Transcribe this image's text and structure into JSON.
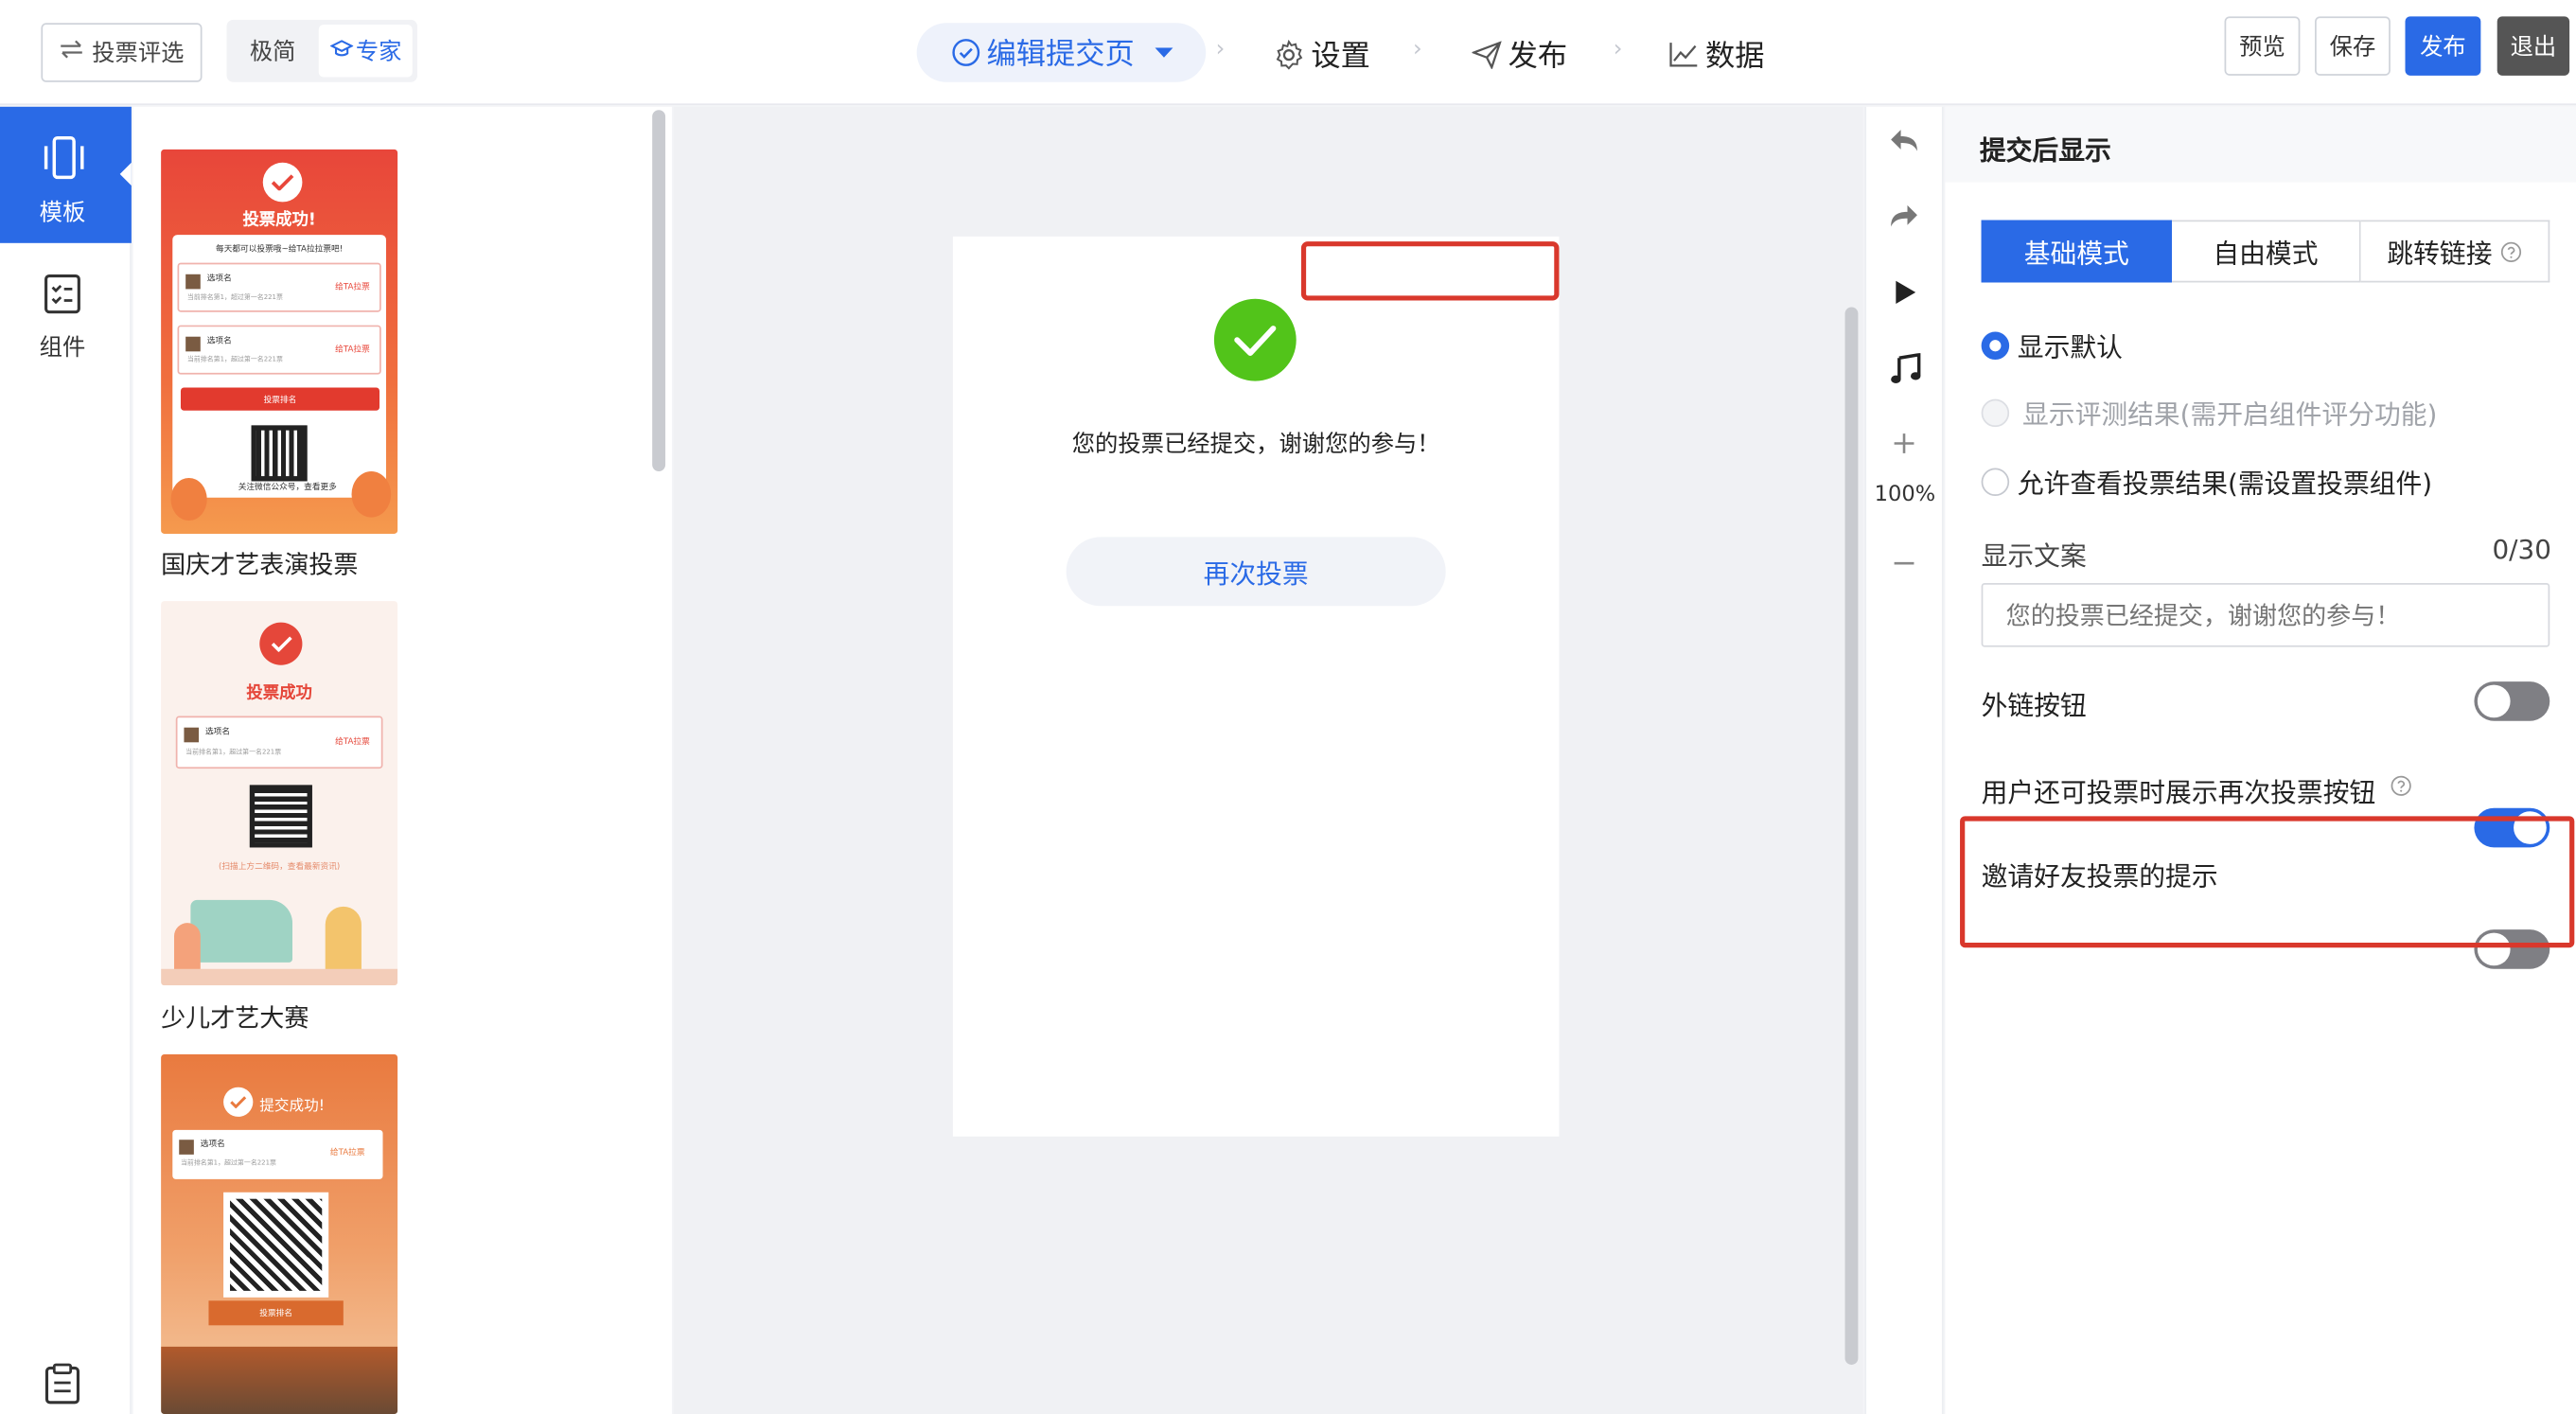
{
  "topbar": {
    "back_label": "投票评选",
    "mode_simple": "极简",
    "mode_expert": "专家",
    "step_edit": "编辑提交页",
    "step_settings": "设置",
    "step_publish": "发布",
    "step_data": "数据",
    "preview_label": "预览",
    "save_label": "保存",
    "publish_label": "发布",
    "exit_label": "退出",
    "accent_color": "#2a6ae6"
  },
  "leftnav": {
    "items": [
      {
        "label": "模板",
        "icon": "phone-frame-icon",
        "active": true
      },
      {
        "label": "组件",
        "icon": "component-list-icon",
        "active": false
      }
    ],
    "bottom_icon": "clipboard-icon"
  },
  "templates": {
    "items": [
      {
        "title": "国庆才艺表演投票",
        "card_title": "投票成功!",
        "card_subtitle": "每天都可以投票哦~给TA拉拉票吧!",
        "entry_name": "选项名",
        "entry_rank": "当前排名第1，超过第一名221票",
        "entry_btn": "给TA拉票",
        "rank_btn": "投票排名",
        "footer": "关注微信公众号，查看更多"
      },
      {
        "title": "少儿才艺大赛",
        "card_title": "投票成功",
        "entry_name": "选项名",
        "entry_rank": "当前排名第1，超过第一名221票",
        "entry_btn": "给TA拉票",
        "footer": "(扫描上方二维码，查看最新资讯)"
      },
      {
        "title": "",
        "card_title": "提交成功!",
        "entry_name": "选项名",
        "entry_rank": "当前排名第1，超过第一名221票",
        "entry_btn": "给TA拉票",
        "rank_btn": "投票排名"
      }
    ]
  },
  "canvas": {
    "message": "您的投票已经提交，谢谢您的参与！",
    "revote_label": "再次投票",
    "success_color": "#52c41a"
  },
  "tools": {
    "zoom": "100%"
  },
  "props": {
    "title": "提交后显示",
    "tabs": [
      "基础模式",
      "自由模式",
      "跳转链接"
    ],
    "active_tab": 0,
    "radios": [
      {
        "label": "显示默认",
        "state": "checked"
      },
      {
        "label": "显示评测结果(需开启组件评分功能)",
        "state": "disabled"
      },
      {
        "label": "允许查看投票结果(需设置投票组件)",
        "state": "unchecked"
      }
    ],
    "text_label": "显示文案",
    "text_count": "0/30",
    "text_placeholder": "您的投票已经提交，谢谢您的参与！",
    "toggles": [
      {
        "label": "外链按钮",
        "on": false
      },
      {
        "label": "用户还可投票时展示再次投票按钮",
        "on": true
      },
      {
        "label": "邀请好友投票的提示",
        "on": false
      }
    ],
    "highlight_color": "#d9382c"
  }
}
